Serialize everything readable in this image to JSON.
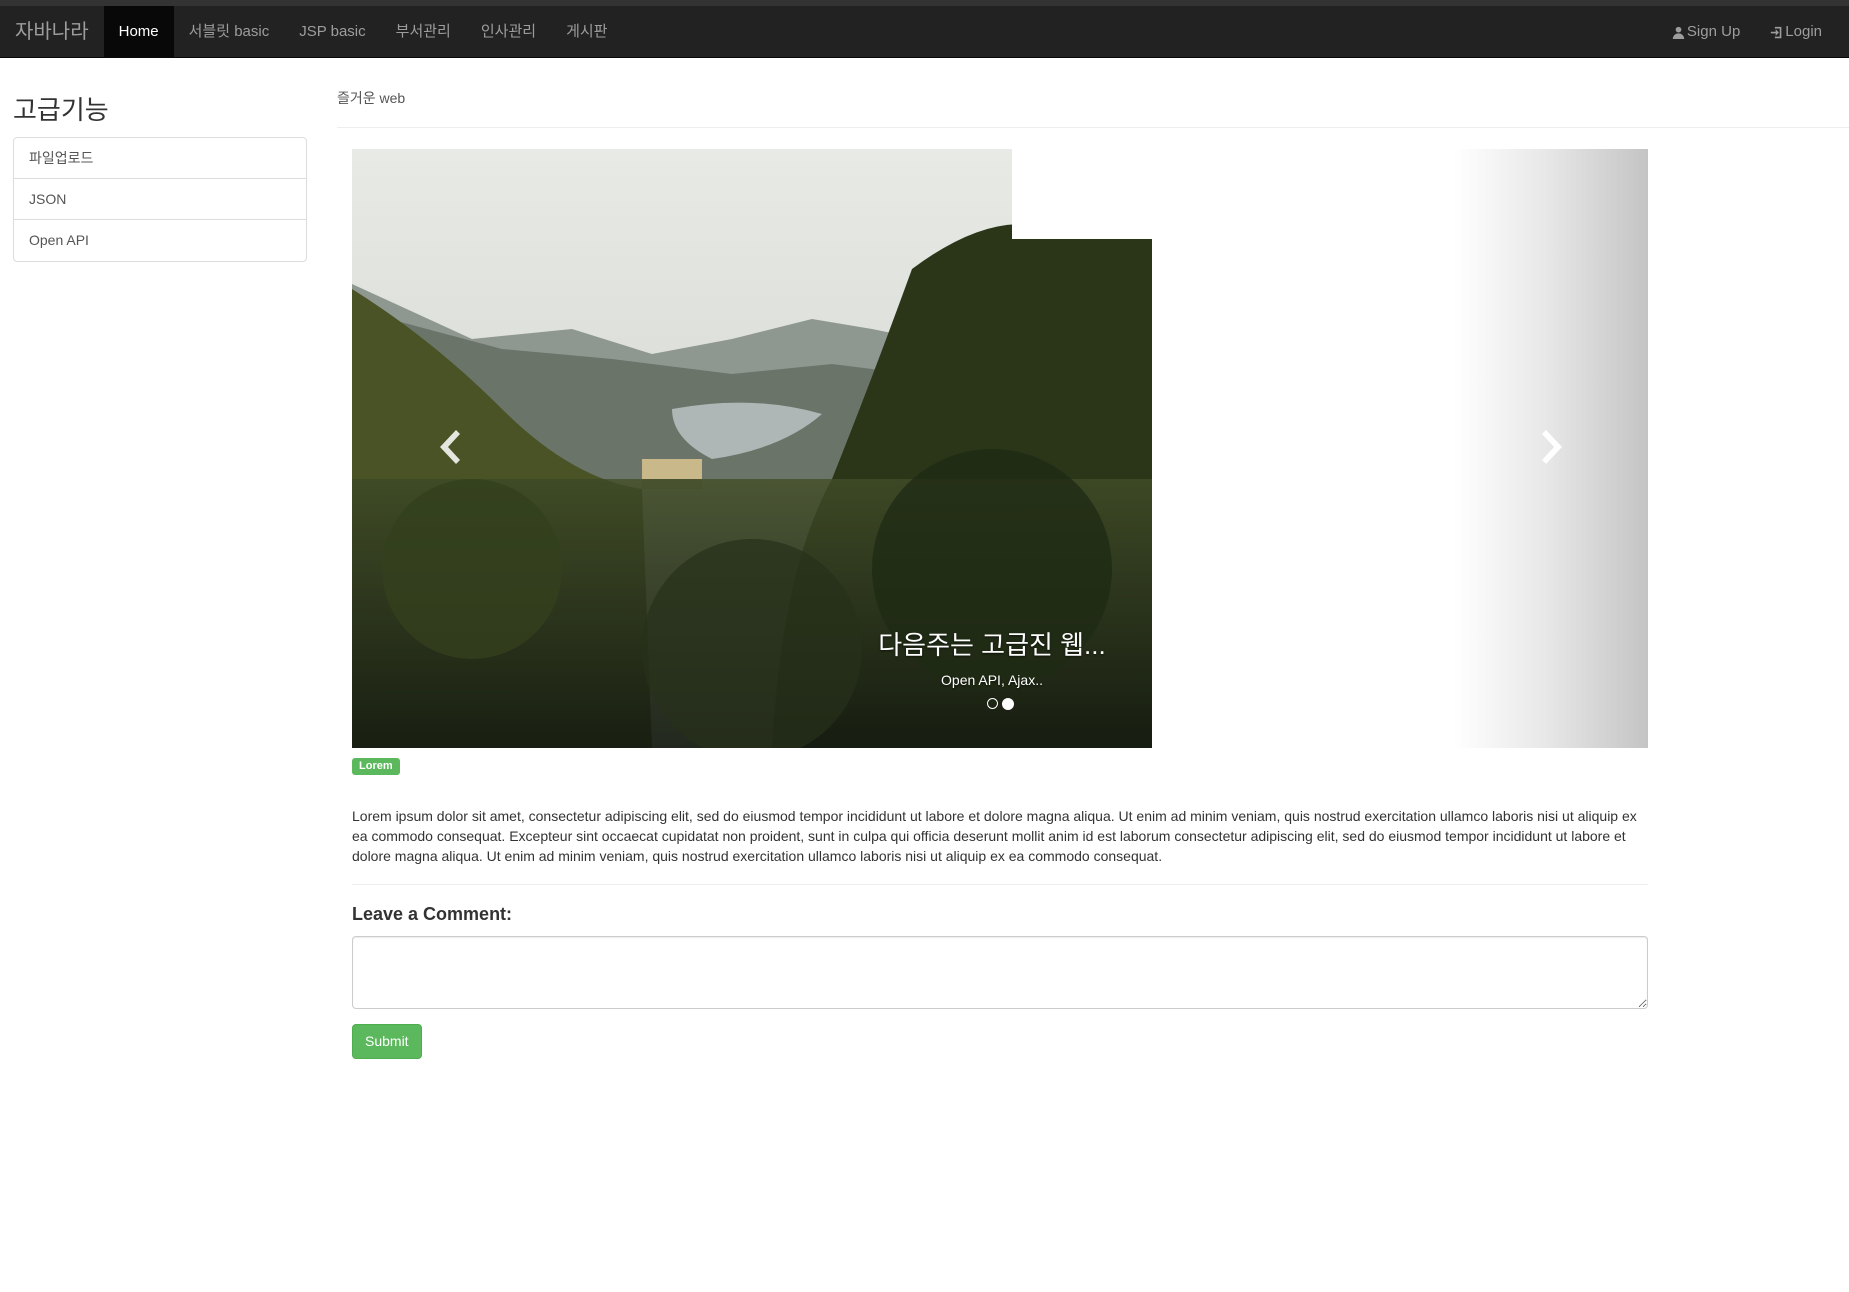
{
  "navbar": {
    "brand": "자바나라",
    "items": [
      {
        "label": "Home",
        "active": true
      },
      {
        "label": "서블릿 basic"
      },
      {
        "label": "JSP basic"
      },
      {
        "label": "부서관리"
      },
      {
        "label": "인사관리"
      },
      {
        "label": "게시판"
      }
    ],
    "right": [
      {
        "label": "Sign Up",
        "icon": "user-icon"
      },
      {
        "label": "Login",
        "icon": "log-in-icon"
      }
    ]
  },
  "sidebar": {
    "title": "고급기능",
    "items": [
      "파일업로드",
      "JSON",
      "Open API"
    ]
  },
  "breadcrumb": "즐거운 web",
  "carousel": {
    "caption_title": "다음주는 고급진 웹...",
    "caption_text": "Open API, Ajax..",
    "slide_count": 2,
    "active_index": 1
  },
  "label": "Lorem",
  "article": "Lorem ipsum dolor sit amet, consectetur adipiscing elit, sed do eiusmod tempor incididunt ut labore et dolore magna aliqua. Ut enim ad minim veniam, quis nostrud exercitation ullamco laboris nisi ut aliquip ex ea commodo consequat. Excepteur sint occaecat cupidatat non proident, sunt in culpa qui officia deserunt mollit anim id est laborum consectetur adipiscing elit, sed do eiusmod tempor incididunt ut labore et dolore magna aliqua. Ut enim ad minim veniam, quis nostrud exercitation ullamco laboris nisi ut aliquip ex ea commodo consequat.",
  "comment": {
    "title": "Leave a Comment:",
    "value": "",
    "submit_label": "Submit"
  },
  "colors": {
    "navbar_bg": "#222222",
    "success": "#5cb85c"
  }
}
